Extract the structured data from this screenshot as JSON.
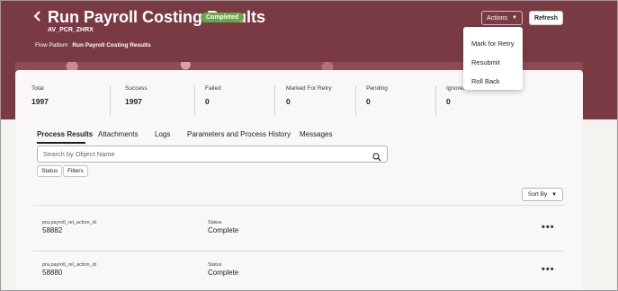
{
  "header": {
    "title": "Run Payroll Costing Results",
    "status_badge": "Completed",
    "code": "AV_PCR_ZHRX",
    "flow_pattern_label": "Flow Pattern",
    "flow_pattern_value": "Run Payroll Costing Results",
    "actions_label": "Actions",
    "refresh_label": "Refresh",
    "banner_color": "#7a3a44",
    "badge_color": "#6ba54a"
  },
  "actions_menu": {
    "items": [
      "Mark for Retry",
      "Resubmit",
      "Roll Back"
    ]
  },
  "stats": [
    {
      "label": "Total",
      "value": "1997"
    },
    {
      "label": "Success",
      "value": "1997"
    },
    {
      "label": "Failed",
      "value": "0"
    },
    {
      "label": "Marked For Retry",
      "value": "0"
    },
    {
      "label": "Pending",
      "value": "0"
    },
    {
      "label": "Ignored",
      "value": "0"
    }
  ],
  "tabs": [
    {
      "label": "Process Results",
      "active": true
    },
    {
      "label": "Attachments",
      "active": false
    },
    {
      "label": "Logs",
      "active": false
    },
    {
      "label": "Parameters and Process History",
      "active": false
    },
    {
      "label": "Messages",
      "active": false
    }
  ],
  "search": {
    "placeholder": "Search by Object Name",
    "value": ""
  },
  "filters": {
    "chips": [
      "Status",
      "Filters"
    ]
  },
  "sort": {
    "label": "Sort By"
  },
  "results": [
    {
      "id_label": "pra.payroll_rel_action_id",
      "id_value": "58882",
      "status_label": "Status",
      "status_value": "Complete"
    },
    {
      "id_label": "pra.payroll_rel_action_id",
      "id_value": "58880",
      "status_label": "Status",
      "status_value": "Complete"
    }
  ]
}
